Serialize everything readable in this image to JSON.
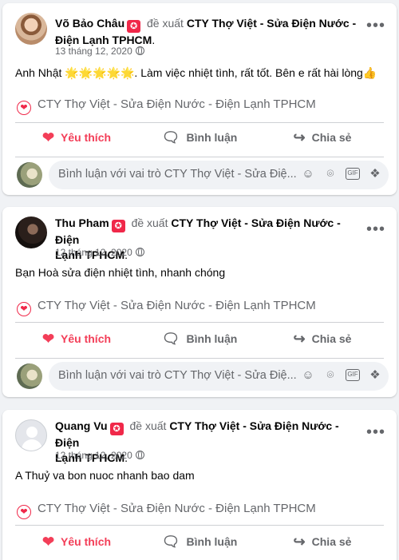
{
  "posts": [
    {
      "name": "Võ Bảo Châu",
      "action": "đề xuất",
      "page_line1": "CTY Thợ Việt - Sửa Điện Nước -",
      "page_line2": "Điện Lạnh TPHCM",
      "date": "13 tháng 12, 2020",
      "text": "Anh Nhật 🌟🌟🌟🌟🌟. Làm việc nhiệt tình, rất tốt. Bên e rất hài lòng👍",
      "recommends": "CTY Thợ Việt - Sửa Điện Nước - Điện Lạnh TPHCM"
    },
    {
      "name": "Thu Pham",
      "action": "đề xuất",
      "page_line1": "CTY Thợ Việt - Sửa Điện Nước - Điện",
      "page_line2": "Lạnh TPHCM",
      "date": "12 tháng 12, 2020",
      "text": "Bạn Hoà sửa điện nhiệt tình, nhanh chóng",
      "recommends": "CTY Thợ Việt - Sửa Điện Nước - Điện Lạnh TPHCM"
    },
    {
      "name": "Quang Vu",
      "action": "đề xuất",
      "page_line1": "CTY Thợ Việt - Sửa Điện Nước - Điện",
      "page_line2": "Lạnh TPHCM",
      "date": "12 tháng 12, 2020",
      "text": "A Thuỷ va bon nuoc nhanh bao dam",
      "recommends": "CTY Thợ Việt - Sửa Điện Nước - Điện Lạnh TPHCM"
    }
  ],
  "actions": {
    "like": "Yêu thích",
    "comment": "Bình luận",
    "share": "Chia sẻ"
  },
  "comment_placeholder": "Bình luận với vai trò CTY Thợ Việt - Sửa Điệ...",
  "icons": {
    "recommend": "recommend-icon",
    "globe": "globe-icon",
    "more": "more-options-icon",
    "heart": "heart-icon",
    "comment": "comment-icon",
    "share": "share-icon",
    "emoji": "emoji-icon",
    "camera": "camera-icon",
    "gif": "gif-icon",
    "sticker": "sticker-icon"
  },
  "colors": {
    "accent_red": "#f33e58",
    "secondary_text": "#65676b",
    "background": "#f0f2f5"
  }
}
